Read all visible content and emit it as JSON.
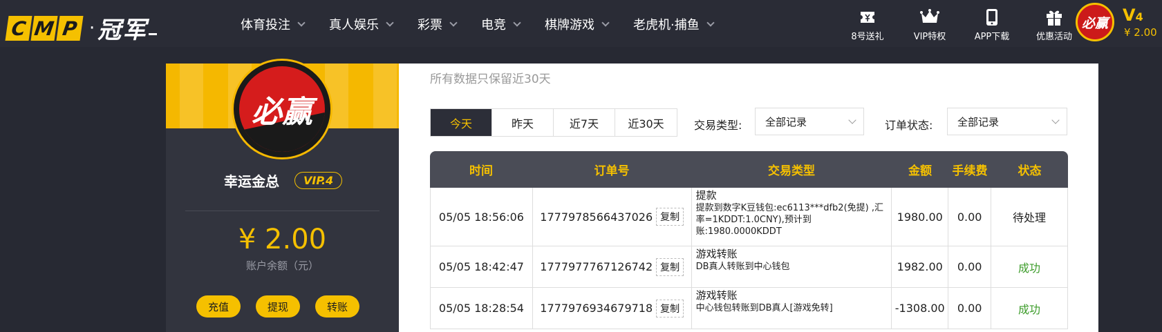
{
  "logo": {
    "letters": [
      "C",
      "M",
      "P"
    ],
    "dot": "·",
    "cn": "冠军"
  },
  "nav": [
    "体育投注",
    "真人娱乐",
    "彩票",
    "电竞",
    "棋牌游戏",
    "老虎机·捕鱼"
  ],
  "tools": [
    {
      "label": "8号送礼",
      "icon": "ticket-icon"
    },
    {
      "label": "VIP特权",
      "icon": "crown-icon"
    },
    {
      "label": "APP下载",
      "icon": "phone-icon"
    },
    {
      "label": "优惠活动",
      "icon": "gift-icon"
    }
  ],
  "user": {
    "avatar_text": "必赢",
    "vip_letter": "V",
    "vip_level": "4",
    "top_balance": "¥ 2.00",
    "name": "幸运金总",
    "badge": "VIP.4",
    "balance": "¥ 2.00",
    "balance_label": "账户余额（元）",
    "actions": [
      "充值",
      "提现",
      "转账"
    ]
  },
  "main": {
    "note": "所有数据只保留近30天",
    "tabs": [
      "今天",
      "昨天",
      "近7天",
      "近30天"
    ],
    "filters": {
      "type_label": "交易类型:",
      "type_value": "全部记录",
      "status_label": "订单状态:",
      "status_value": "全部记录"
    },
    "columns": [
      "时间",
      "订单号",
      "交易类型",
      "金额",
      "手续费",
      "状态"
    ],
    "copy_label": "复制",
    "rows": [
      {
        "time": "05/05 18:56:06",
        "order": "1777978566437026",
        "type": "提款",
        "desc": "提款到数字K豆钱包:ec6113***dfb2(免提) ,汇率=1KDDT:1.0CNY),预计到账:1980.0000KDDT",
        "amount": "1980.00",
        "fee": "0.00",
        "status": "待处理"
      },
      {
        "time": "05/05 18:42:47",
        "order": "1777977767126742",
        "type": "游戏转账",
        "desc": "DB真人转账到中心钱包",
        "amount": "1982.00",
        "fee": "0.00",
        "status": "成功"
      },
      {
        "time": "05/05 18:28:54",
        "order": "1777976934679718",
        "type": "游戏转账",
        "desc": "中心钱包转账到DB真人[游戏免转]",
        "amount": "-1308.00",
        "fee": "0.00",
        "status": "成功"
      }
    ]
  },
  "colors": {
    "accent": "#f5c000",
    "nav_bg": "#2a2c36",
    "success": "#3c9c2a"
  }
}
